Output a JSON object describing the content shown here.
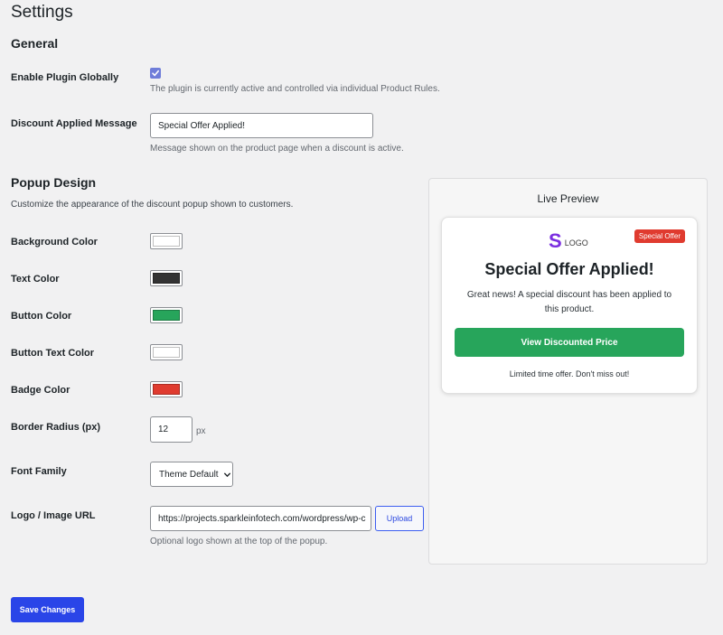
{
  "page": {
    "title": "Settings"
  },
  "general": {
    "title": "General",
    "enable_plugin": {
      "label": "Enable Plugin Globally",
      "checked": true,
      "description": "The plugin is currently active and controlled via individual Product Rules."
    },
    "discount_message": {
      "label": "Discount Applied Message",
      "value": "Special Offer Applied!",
      "description": "Message shown on the product page when a discount is active."
    }
  },
  "popup_design": {
    "title": "Popup Design",
    "description": "Customize the appearance of the discount popup shown to customers.",
    "colors": [
      {
        "label": "Background Color",
        "value": "#ffffff"
      },
      {
        "label": "Text Color",
        "value": "#333333"
      },
      {
        "label": "Button Color",
        "value": "#27a55b"
      },
      {
        "label": "Button Text Color",
        "value": "#ffffff"
      },
      {
        "label": "Badge Color",
        "value": "#e03b2f"
      }
    ],
    "border_radius": {
      "label": "Border Radius (px)",
      "value": "12",
      "unit": "px"
    },
    "font_family": {
      "label": "Font Family",
      "selected": "Theme Default"
    },
    "logo_url": {
      "label": "Logo / Image URL",
      "value": "https://projects.sparkleinfotech.com/wordpress/wp-c",
      "upload_label": "Upload",
      "description": "Optional logo shown at the top of the popup."
    }
  },
  "live_preview": {
    "title": "Live Preview",
    "logo_letter": "S",
    "logo_text": "LOGO",
    "badge": "Special Offer",
    "heading": "Special Offer Applied!",
    "body": "Great news! A special discount has been applied to this product.",
    "button": "View Discounted Price",
    "footer": "Limited time offer. Don't miss out!"
  },
  "save_label": "Save Changes",
  "icons": {
    "checkbox": "check-icon",
    "select": "chevron-down-icon"
  }
}
